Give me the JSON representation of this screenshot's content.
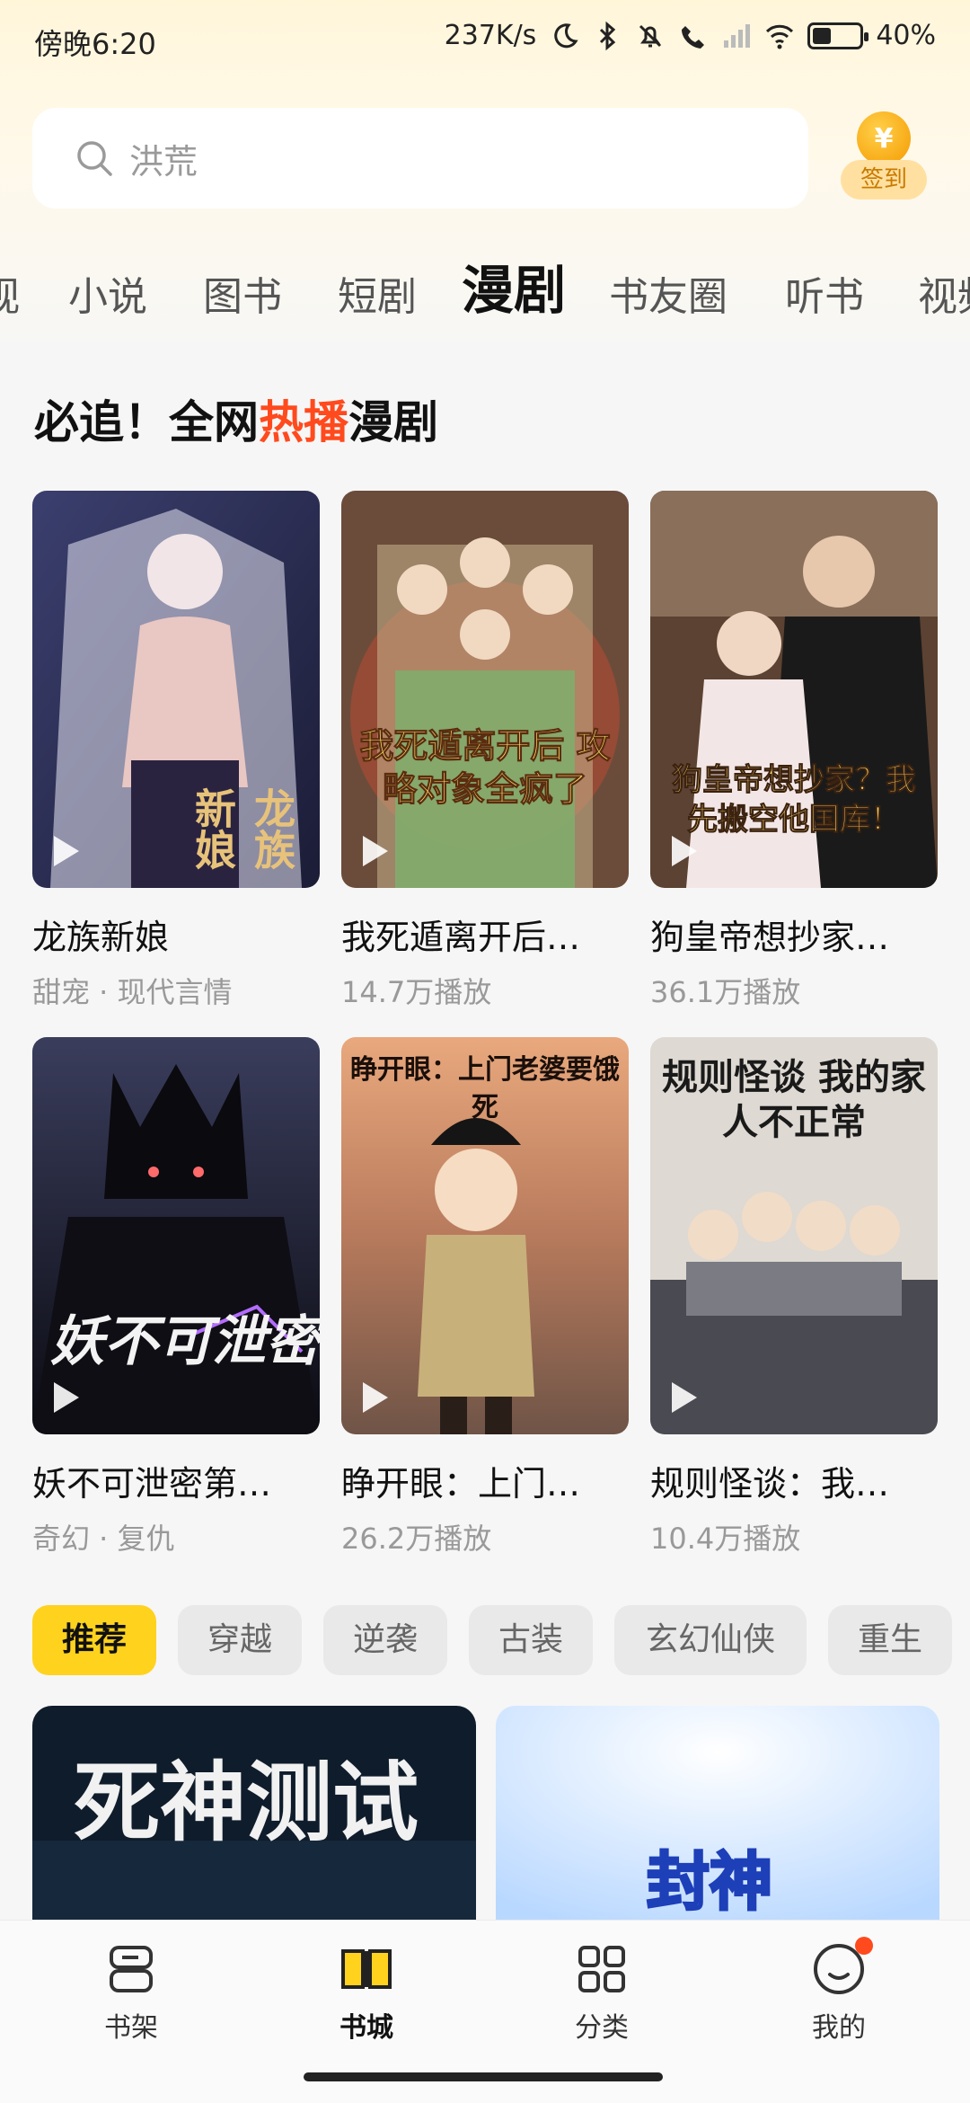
{
  "status": {
    "time": "傍晚6:20",
    "network_speed": "237K/s",
    "battery_text": "40%",
    "battery_level": 0.4
  },
  "search": {
    "placeholder": "洪荒"
  },
  "signin": {
    "label": "签到",
    "coin_symbol": "¥"
  },
  "tabs": [
    {
      "label": "视",
      "active": false
    },
    {
      "label": "小说",
      "active": false
    },
    {
      "label": "图书",
      "active": false
    },
    {
      "label": "短剧",
      "active": false
    },
    {
      "label": "漫剧",
      "active": true
    },
    {
      "label": "书友圈",
      "active": false
    },
    {
      "label": "听书",
      "active": false
    },
    {
      "label": "视频",
      "active": false
    }
  ],
  "section": {
    "title_prefix": "必追！全网",
    "title_hot": "热播",
    "title_suffix": "漫剧"
  },
  "cards": [
    {
      "title": "龙族新娘",
      "meta": "甜宠 · 现代言情",
      "cover_text": "龙族新娘"
    },
    {
      "title": "我死遁离开后…",
      "meta": "14.7万播放",
      "cover_text": "我死遁离开后 攻略对象全疯了"
    },
    {
      "title": "狗皇帝想抄家…",
      "meta": "36.1万播放",
      "cover_text": "狗皇帝想抄家？我先搬空他国库！"
    },
    {
      "title": "妖不可泄密第…",
      "meta": "奇幻 · 复仇",
      "cover_text": "妖不可泄密"
    },
    {
      "title": "睁开眼：上门…",
      "meta": "26.2万播放",
      "cover_text": "睁开眼：上门老婆要饿死"
    },
    {
      "title": "规则怪谈：我…",
      "meta": "10.4万播放",
      "cover_text": "规则怪谈 我的家人不正常"
    }
  ],
  "chips": [
    {
      "label": "推荐",
      "active": true
    },
    {
      "label": "穿越",
      "active": false
    },
    {
      "label": "逆袭",
      "active": false
    },
    {
      "label": "古装",
      "active": false
    },
    {
      "label": "玄幻仙侠",
      "active": false
    },
    {
      "label": "重生",
      "active": false
    }
  ],
  "banners": [
    {
      "text": "死神测试"
    },
    {
      "text": "封神"
    }
  ],
  "nav": [
    {
      "label": "书架",
      "icon": "bookshelf-icon",
      "active": false
    },
    {
      "label": "书城",
      "icon": "bookstore-icon",
      "active": true
    },
    {
      "label": "分类",
      "icon": "category-icon",
      "active": false
    },
    {
      "label": "我的",
      "icon": "profile-icon",
      "active": false
    }
  ],
  "colors": {
    "accent": "#ffd21e",
    "hot": "#ff4a1d"
  }
}
